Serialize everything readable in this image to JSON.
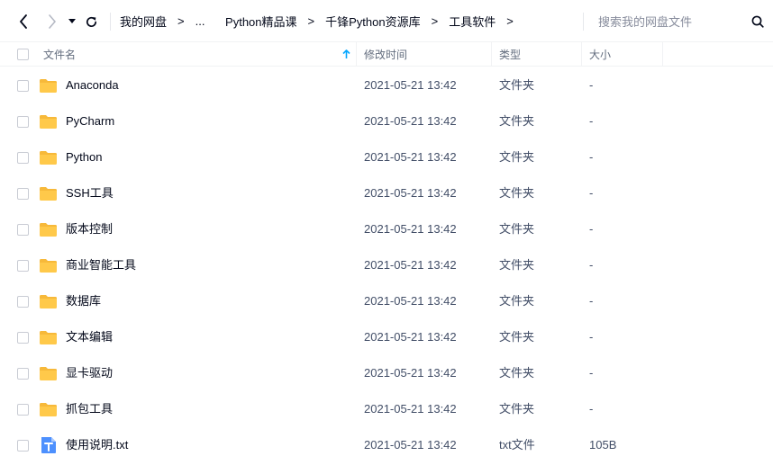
{
  "toolbar": {
    "back_icon": "chevron-left-icon",
    "forward_icon": "chevron-right-icon",
    "dropdown_icon": "caret-down-icon",
    "refresh_icon": "refresh-icon"
  },
  "breadcrumb": {
    "items": [
      "我的网盘",
      "...",
      "Python精品课",
      "千锋Python资源库",
      "工具软件"
    ],
    "separator": ">"
  },
  "search": {
    "placeholder": "搜索我的网盘文件",
    "icon": "search-icon"
  },
  "columns": {
    "name": "文件名",
    "time": "修改时间",
    "type": "类型",
    "size": "大小"
  },
  "colors": {
    "folder": "#ffc94a",
    "folder_tab": "#f7b93a",
    "txt_icon": "#4d90fe",
    "sort_arrow": "#06a7ff"
  },
  "files": [
    {
      "name": "Anaconda",
      "time": "2021-05-21 13:42",
      "type": "文件夹",
      "size": "-",
      "icon": "folder-icon"
    },
    {
      "name": "PyCharm",
      "time": "2021-05-21 13:42",
      "type": "文件夹",
      "size": "-",
      "icon": "folder-icon"
    },
    {
      "name": "Python",
      "time": "2021-05-21 13:42",
      "type": "文件夹",
      "size": "-",
      "icon": "folder-icon"
    },
    {
      "name": "SSH工具",
      "time": "2021-05-21 13:42",
      "type": "文件夹",
      "size": "-",
      "icon": "folder-icon"
    },
    {
      "name": "版本控制",
      "time": "2021-05-21 13:42",
      "type": "文件夹",
      "size": "-",
      "icon": "folder-icon"
    },
    {
      "name": "商业智能工具",
      "time": "2021-05-21 13:42",
      "type": "文件夹",
      "size": "-",
      "icon": "folder-icon"
    },
    {
      "name": "数据库",
      "time": "2021-05-21 13:42",
      "type": "文件夹",
      "size": "-",
      "icon": "folder-icon"
    },
    {
      "name": "文本编辑",
      "time": "2021-05-21 13:42",
      "type": "文件夹",
      "size": "-",
      "icon": "folder-icon"
    },
    {
      "name": "显卡驱动",
      "time": "2021-05-21 13:42",
      "type": "文件夹",
      "size": "-",
      "icon": "folder-icon"
    },
    {
      "name": "抓包工具",
      "time": "2021-05-21 13:42",
      "type": "文件夹",
      "size": "-",
      "icon": "folder-icon"
    },
    {
      "name": "使用说明.txt",
      "time": "2021-05-21 13:42",
      "type": "txt文件",
      "size": "105B",
      "icon": "txt-file-icon"
    }
  ]
}
